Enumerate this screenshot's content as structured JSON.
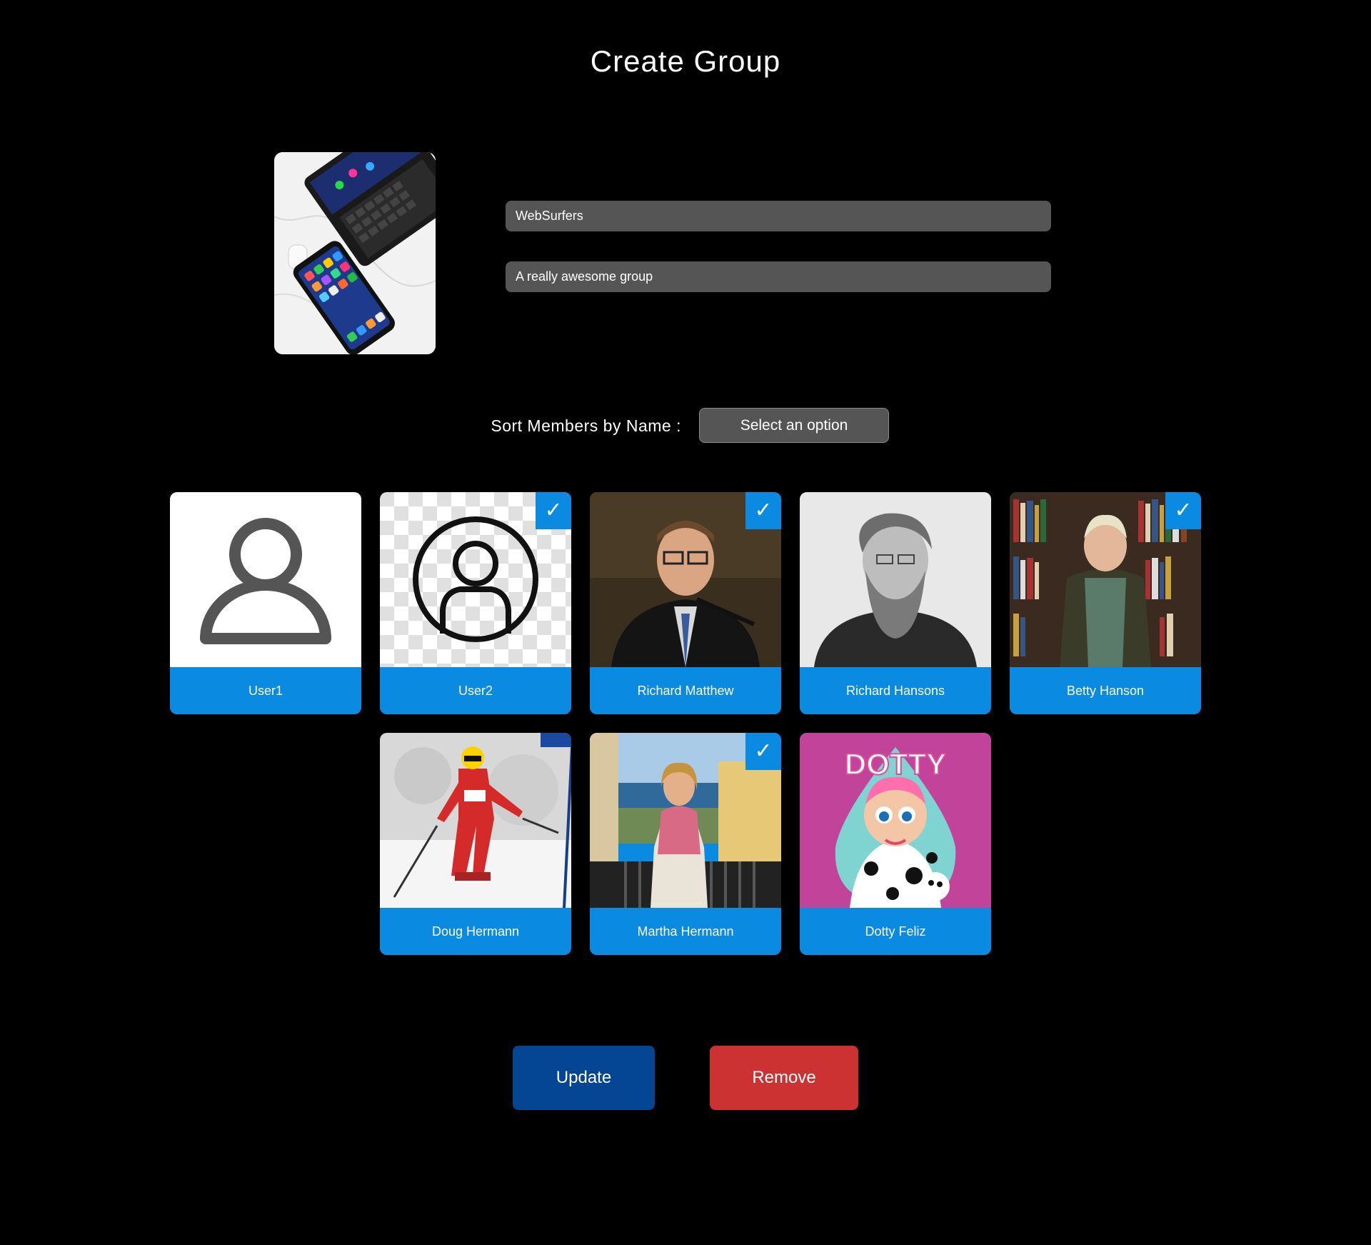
{
  "page": {
    "title": "Create Group"
  },
  "group": {
    "image_alt": "phone and tablet",
    "name_value": "WebSurfers",
    "description_value": "A really awesome group"
  },
  "sort": {
    "label": "Sort Members by Name :",
    "selected_option": "Select an option"
  },
  "members": [
    {
      "name": "User1",
      "selected": false,
      "avatar": "person-outline-icon"
    },
    {
      "name": "User2",
      "selected": true,
      "avatar": "person-circle-icon"
    },
    {
      "name": "Richard Matthew",
      "selected": true,
      "avatar": "photo"
    },
    {
      "name": "Richard Hansons",
      "selected": false,
      "avatar": "photo"
    },
    {
      "name": "Betty Hanson",
      "selected": true,
      "avatar": "photo"
    },
    {
      "name": "Doug Hermann",
      "selected": false,
      "avatar": "photo"
    },
    {
      "name": "Martha Hermann",
      "selected": true,
      "avatar": "photo"
    },
    {
      "name": "Dotty Feliz",
      "selected": false,
      "avatar": "photo",
      "photo_text": "DOTTY"
    }
  ],
  "check_mark": "✓",
  "actions": {
    "update_label": "Update",
    "remove_label": "Remove"
  },
  "colors": {
    "background": "#000000",
    "input_background": "#555555",
    "card_accent": "#0a8ae0",
    "update_button": "#044594",
    "remove_button": "#cc3232"
  }
}
